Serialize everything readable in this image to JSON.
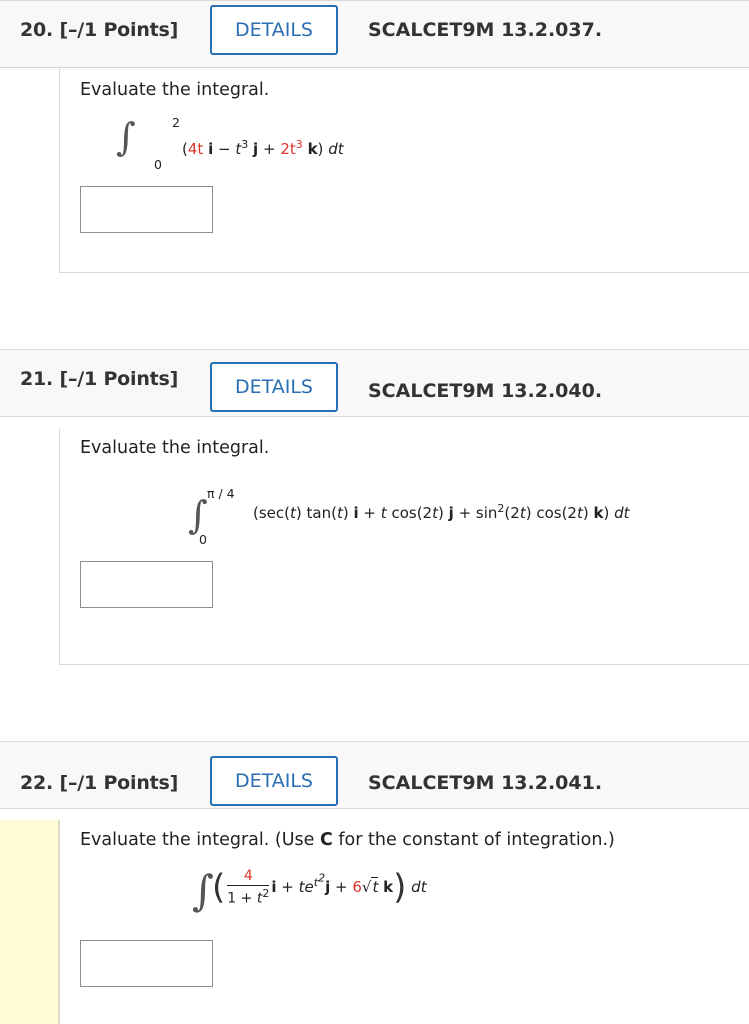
{
  "questions": [
    {
      "number": "20.",
      "points": "[–/1 Points]",
      "details_label": "DETAILS",
      "code": "SCALCET9M 13.2.037.",
      "prompt": "Evaluate the integral.",
      "integral": {
        "lower": "0",
        "upper": "2",
        "open": "(",
        "t1_coef": "4t",
        "i": "i",
        "minus": "−",
        "t3": "t",
        "t3_exp": "3",
        "j": "j",
        "plus": "+",
        "k_coef": "2t",
        "k_exp": "3",
        "k": "k",
        "close": ")",
        "dt": "dt"
      },
      "answer_value": ""
    },
    {
      "number": "21.",
      "points": "[–/1 Points]",
      "details_label": "DETAILS",
      "code": "SCALCET9M 13.2.040.",
      "prompt": "Evaluate the integral.",
      "integral": {
        "lower": "0",
        "upper": "π / 4",
        "expr_a": "(sec(",
        "t": "t",
        "expr_b": ") tan(",
        "expr_c": ")",
        "i": "i",
        "plus1": "+",
        "expr_d": "cos(2",
        "expr_e": ")",
        "j": "j",
        "plus2": "+",
        "expr_f": "sin",
        "sin_exp": "2",
        "expr_g": "(2",
        "expr_h": ") cos(2",
        "expr_i": ")",
        "k": "k",
        "close": ")",
        "dt": "dt"
      },
      "answer_value": ""
    },
    {
      "number": "22.",
      "points": "[–/1 Points]",
      "details_label": "DETAILS",
      "code": "SCALCET9M 13.2.041.",
      "prompt_a": "Evaluate the integral. (Use ",
      "prompt_c": "C",
      "prompt_b": " for the constant of integration.)",
      "integral": {
        "numerator": "4",
        "denominator_a": "1 + ",
        "denominator_t": "t",
        "denominator_exp": "2",
        "i": "i",
        "plus1": "+",
        "te": "te",
        "exp_t": "t",
        "exp_2": "2",
        "j": "j",
        "plus2": "+",
        "coef6": "6",
        "sqrt_t": "t",
        "k": "k",
        "dt": "dt"
      },
      "answer_value": ""
    }
  ],
  "colors": {
    "accent": "#2a6eb3",
    "red": "#d9342b",
    "active_bar": "#fffbd6"
  }
}
